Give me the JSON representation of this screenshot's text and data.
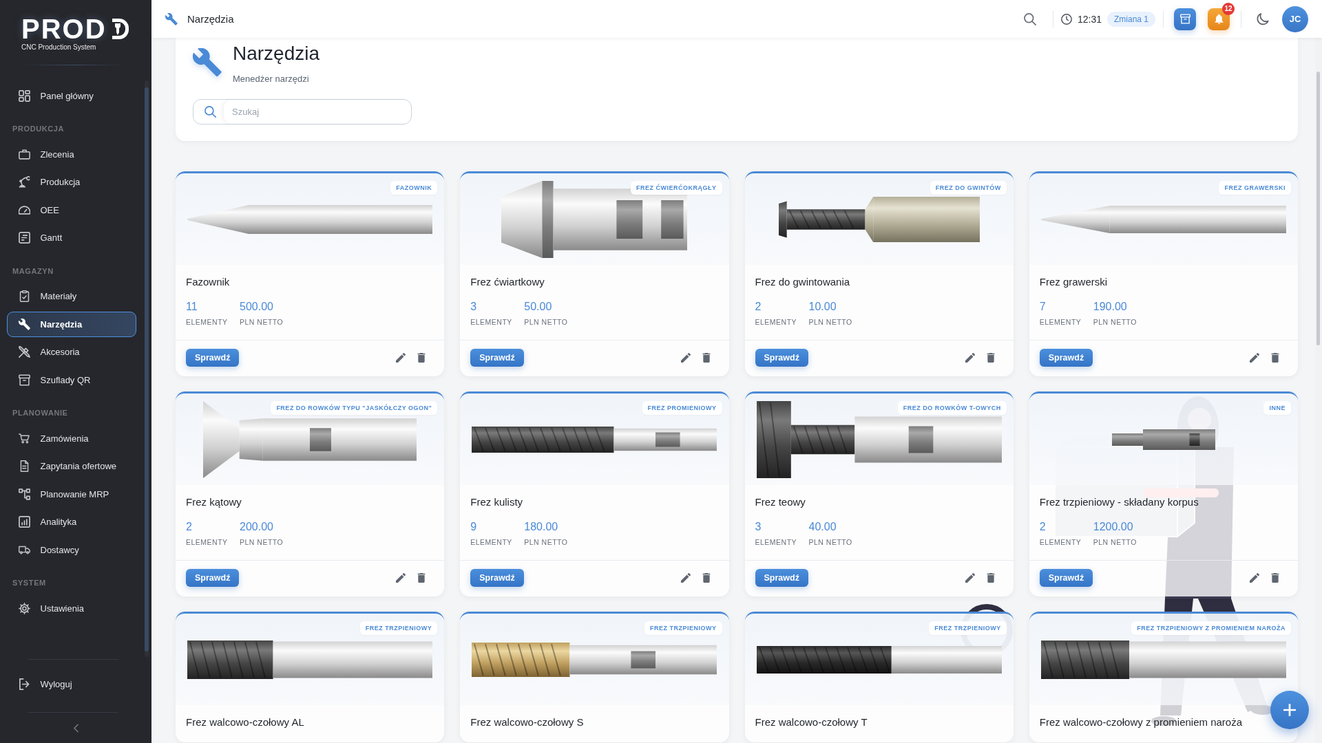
{
  "sidebar": {
    "logo": {
      "text": "PROD",
      "tagline": "CNC Production System"
    },
    "sections": [
      {
        "items": [
          {
            "label": "Panel główny",
            "selected": false
          }
        ]
      },
      {
        "title": "PRODUKCJA",
        "items": [
          {
            "label": "Zlecenia",
            "selected": false
          },
          {
            "label": "Produkcja",
            "selected": false
          },
          {
            "label": "OEE",
            "selected": false
          },
          {
            "label": "Gantt",
            "selected": false
          }
        ]
      },
      {
        "title": "MAGAZYN",
        "items": [
          {
            "label": "Materiały",
            "selected": false
          },
          {
            "label": "Narzędzia",
            "selected": true
          },
          {
            "label": "Akcesoria",
            "selected": false
          },
          {
            "label": "Szuflady QR",
            "selected": false
          }
        ]
      },
      {
        "title": "PLANOWANIE",
        "items": [
          {
            "label": "Zamówienia",
            "selected": false
          },
          {
            "label": "Zapytania ofertowe",
            "selected": false
          },
          {
            "label": "Planowanie MRP",
            "selected": false
          },
          {
            "label": "Analityka",
            "selected": false
          },
          {
            "label": "Dostawcy",
            "selected": false
          }
        ]
      },
      {
        "title": "SYSTEM",
        "items": [
          {
            "label": "Ustawienia",
            "selected": false
          }
        ]
      }
    ],
    "logout": {
      "label": "Wyloguj"
    }
  },
  "topbar": {
    "title": "Narzędzia",
    "time": "12:31",
    "shift": "Zmiana 1",
    "notifications": "12",
    "avatar": "JC"
  },
  "header": {
    "title": "Narzędzia",
    "subtitle": "Menedżer narzędzi",
    "search": {
      "placeholder": "Szukaj"
    }
  },
  "tools": [
    {
      "category": "FAZOWNIK",
      "name": "Fazownik",
      "count": "11",
      "count_label": "ELEMENTY",
      "price": "500.00",
      "price_label": "PLN NETTO",
      "button": "Sprawdź"
    },
    {
      "category": "FREZ ĆWIERĆOKRĄGŁY",
      "name": "Frez ćwiartkowy",
      "count": "3",
      "count_label": "ELEMENTY",
      "price": "50.00",
      "price_label": "PLN NETTO",
      "button": "Sprawdź"
    },
    {
      "category": "FREZ DO GWINTÓW",
      "name": "Frez do gwintowania",
      "count": "2",
      "count_label": "ELEMENTY",
      "price": "10.00",
      "price_label": "PLN NETTO",
      "button": "Sprawdź"
    },
    {
      "category": "FREZ GRAWERSKI",
      "name": "Frez grawerski",
      "count": "7",
      "count_label": "ELEMENTY",
      "price": "190.00",
      "price_label": "PLN NETTO",
      "button": "Sprawdź"
    },
    {
      "category": "FREZ DO ROWKÓW TYPU \"JASKÓŁCZY OGON\"",
      "name": "Frez kątowy",
      "count": "2",
      "count_label": "ELEMENTY",
      "price": "200.00",
      "price_label": "PLN NETTO",
      "button": "Sprawdź"
    },
    {
      "category": "FREZ PROMIENIOWY",
      "name": "Frez kulisty",
      "count": "9",
      "count_label": "ELEMENTY",
      "price": "180.00",
      "price_label": "PLN NETTO",
      "button": "Sprawdź"
    },
    {
      "category": "FREZ DO ROWKÓW T-OWYCH",
      "name": "Frez teowy",
      "count": "3",
      "count_label": "ELEMENTY",
      "price": "40.00",
      "price_label": "PLN NETTO",
      "button": "Sprawdź"
    },
    {
      "category": "INNE",
      "name": "Frez trzpieniowy - składany korpus",
      "count": "2",
      "count_label": "ELEMENTY",
      "price": "1200.00",
      "price_label": "PLN NETTO",
      "button": "Sprawdź"
    },
    {
      "category": "FREZ TRZPIENIOWY",
      "name": "Frez walcowo-czołowy AL"
    },
    {
      "category": "FREZ TRZPIENIOWY",
      "name": "Frez walcowo-czołowy S"
    },
    {
      "category": "FREZ TRZPIENIOWY",
      "name": "Frez walcowo-czołowy T"
    },
    {
      "category": "FREZ TRZPIENIOWY Z PROMIENIEM NAROŻA",
      "name": "Frez walcowo-czołowy z promieniem naroża"
    }
  ]
}
